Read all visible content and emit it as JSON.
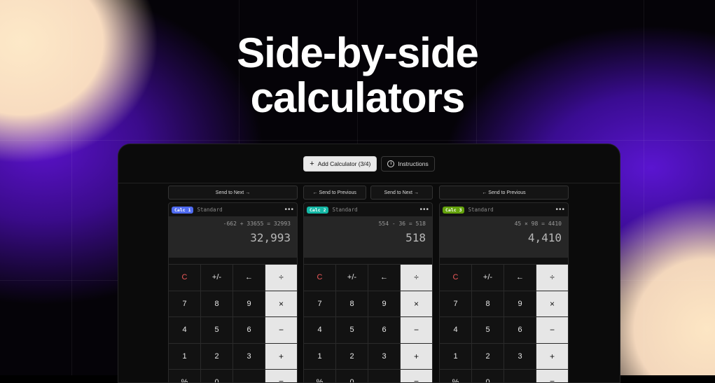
{
  "hero": {
    "line1": "Side-by-side",
    "line2": "calculators"
  },
  "toolbar": {
    "add_label": "Add Calculator (3/4)",
    "instructions_label": "Instructions"
  },
  "calculators": [
    {
      "send_buttons": [
        "Send to Next →"
      ],
      "badge": "Calc 1",
      "badge_color": "#4f6bf0",
      "mode": "Standard",
      "expression": "-662 + 33655 = 32993",
      "result": "32,993"
    },
    {
      "send_buttons": [
        "← Send to Previous",
        "Send to Next →"
      ],
      "badge": "Calc 2",
      "badge_color": "#14b8a6",
      "mode": "Standard",
      "expression": "554 - 36 = 518",
      "result": "518"
    },
    {
      "send_buttons": [
        "← Send to Previous"
      ],
      "badge": "Calc 3",
      "badge_color": "#65a30d",
      "mode": "Standard",
      "expression": "45 × 98 = 4410",
      "result": "4,410"
    }
  ],
  "keypad": [
    [
      "C",
      "+/-",
      "←",
      "÷"
    ],
    [
      "7",
      "8",
      "9",
      "×"
    ],
    [
      "4",
      "5",
      "6",
      "−"
    ],
    [
      "1",
      "2",
      "3",
      "+"
    ],
    [
      "%",
      "0",
      "",
      "="
    ]
  ],
  "icons": {
    "more": "more-dots-icon",
    "plus": "plus-icon",
    "info": "info-icon"
  }
}
